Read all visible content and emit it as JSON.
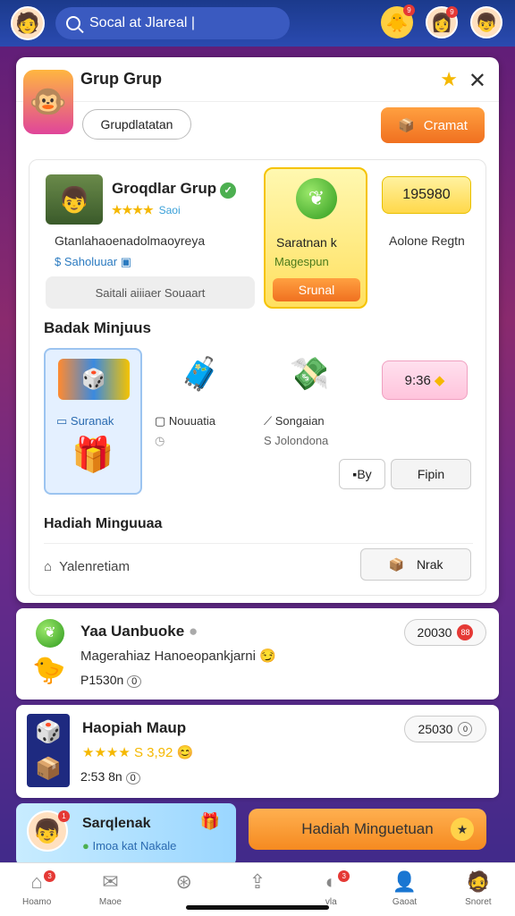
{
  "topbar": {
    "search_text": "Socal at Jlareal |",
    "badge_a": "9",
    "badge_b": "9"
  },
  "panel": {
    "title": "Grup Grup",
    "chip": "Grupdlatatan",
    "orange_button": "Cramat",
    "group": {
      "name": "Groqdlar Grup",
      "stars": "★★★★",
      "stars_note": "Saoi",
      "desc": "Gtanlahaoenadolmaoyreya",
      "sub": "Saholuuar",
      "button": "Saitali aiiiaer Souaart"
    },
    "yellow_card": {
      "label": "Saratnan   k",
      "sub": "Magespun",
      "button": "Srunal"
    },
    "number_box": "195980",
    "right_label": "Aolone Regtn",
    "section_title": "Badak Minjuus",
    "blue_card_label": "Suranak",
    "items": [
      {
        "label": "Nouuatia",
        "sub": ""
      },
      {
        "label": "Songaian",
        "sub": "S Jolondona"
      }
    ],
    "pink_box": "9:36",
    "by_button": "By",
    "fpin_button": "Fipin",
    "hadiah_title": "Hadiah Minguuaa",
    "footer_label": "Yalenretiam",
    "nrak_button": "Nrak"
  },
  "list": [
    {
      "title": "Yaa Uanbuoke",
      "desc": "Magerahiaz Hanoeopankjarni",
      "meta": "P1530n",
      "meta_badge": "0",
      "pill": "20030",
      "pill_badge": "88"
    },
    {
      "title": "Haopiah Maup",
      "desc": "★★★★ S 3,92",
      "meta": "2:53 8n",
      "meta_badge": "0",
      "pill": "25030",
      "pill_badge": "0"
    }
  ],
  "promo": {
    "title": "Sarqlenak",
    "sub": "Imoa kat Nakale",
    "badge": "1",
    "button": "Hadiah Minguetuan"
  },
  "nav": [
    {
      "label": "Hoamo",
      "badge": "3"
    },
    {
      "label": "Maoe",
      "badge": ""
    },
    {
      "label": "",
      "badge": ""
    },
    {
      "label": "",
      "badge": ""
    },
    {
      "label": "vla",
      "badge": "3"
    },
    {
      "label": "Gaoat",
      "badge": ""
    },
    {
      "label": "Snoret",
      "badge": ""
    }
  ]
}
